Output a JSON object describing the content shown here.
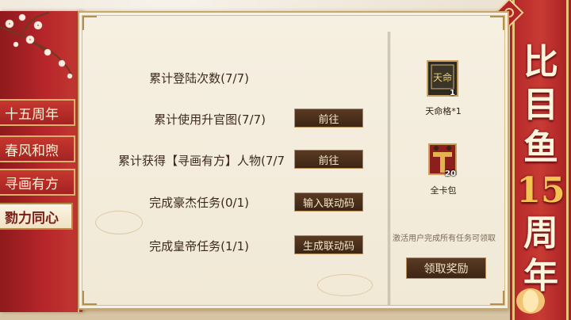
{
  "banner": {
    "title_chars": [
      "比",
      "目",
      "鱼",
      "15",
      "周",
      "年"
    ]
  },
  "tabs": [
    {
      "label": "十五周年",
      "active": false
    },
    {
      "label": "春风和煦",
      "active": false
    },
    {
      "label": "寻画有方",
      "active": false
    },
    {
      "label": "勠力同心",
      "active": true
    }
  ],
  "tasks": [
    {
      "label": "累计登陆次数(7/7)",
      "button": ""
    },
    {
      "label": "累计使用升官图(7/7)",
      "button": "前往"
    },
    {
      "label": "累计获得【寻画有方】人物(7/7",
      "button": "前往"
    },
    {
      "label": "完成豪杰任务(0/1)",
      "button": "输入联动码"
    },
    {
      "label": "完成皇帝任务(1/1)",
      "button": "生成联动码"
    }
  ],
  "rewards": [
    {
      "name": "天命格*1",
      "qty": "1",
      "icon_text": "天命",
      "icon": "fate-card-icon"
    },
    {
      "name": "全卡包",
      "qty": "20",
      "icon": "card-pack-icon"
    }
  ],
  "reward_hint": "激活用户完成所有任务可领取",
  "claim_button": "领取奖励",
  "colors": {
    "banner_red": "#b22628",
    "gold": "#e8c57d",
    "button_brown": "#3d2616",
    "parchment": "#f6f0e2"
  }
}
